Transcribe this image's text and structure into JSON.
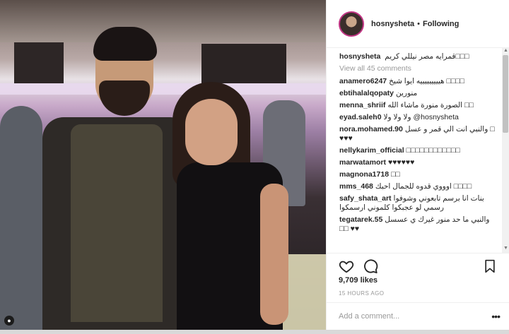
{
  "post": {
    "username": "hosnysheta",
    "separator": "•",
    "follow_status": "Following",
    "likes": "9,709 likes",
    "time": "15 HOURS AGO",
    "add_comment_placeholder": "Add a comment...",
    "more_label": "•••"
  },
  "caption": {
    "user": "hosnysheta",
    "text": "قمرايه مصر نيللي كريم□□□"
  },
  "view_all": "View all 45 comments",
  "comments": [
    {
      "user": "anamero6247",
      "text": "هيييييييييه ايوا شيخ □□□□"
    },
    {
      "user": "ebtihalalqopaty",
      "text": "منورين"
    },
    {
      "user": "menna_shriif",
      "text": "الصورة منورة ماشاء الله □□"
    },
    {
      "user": "eyad.saleh0",
      "text": "ولا ولا ولا @hosnysheta"
    },
    {
      "user": "nora.mohamed.90",
      "text": "والنبي انت الي قمر و عسل □ ♥♥♥"
    },
    {
      "user": "nellykarim_official",
      "text": "□□□□□□□□□□□□"
    },
    {
      "user": "marwatamort",
      "text": "♥♥♥♥♥♥"
    },
    {
      "user": "magnona1718",
      "text": "□□"
    },
    {
      "user": "mms_468",
      "text": "اوووي قدوه للجمال احبك □□□□"
    },
    {
      "user": "safy_shata_art",
      "text": "بنات انا برسم تابعوني وشوفوا رسمي لو عجبكوا كلموني ارسمكوا"
    },
    {
      "user": "tegatarek.55",
      "text": "والنبي ما حد منور غيرك ي عسسل □□ ♥♥"
    }
  ],
  "icons": {
    "heart": "heart-icon",
    "comment": "comment-icon",
    "bookmark": "bookmark-icon",
    "user_tag": "user-tag-icon"
  },
  "colors": {
    "avatar_ring": "#c13584",
    "text": "#262626",
    "muted": "#999999"
  }
}
